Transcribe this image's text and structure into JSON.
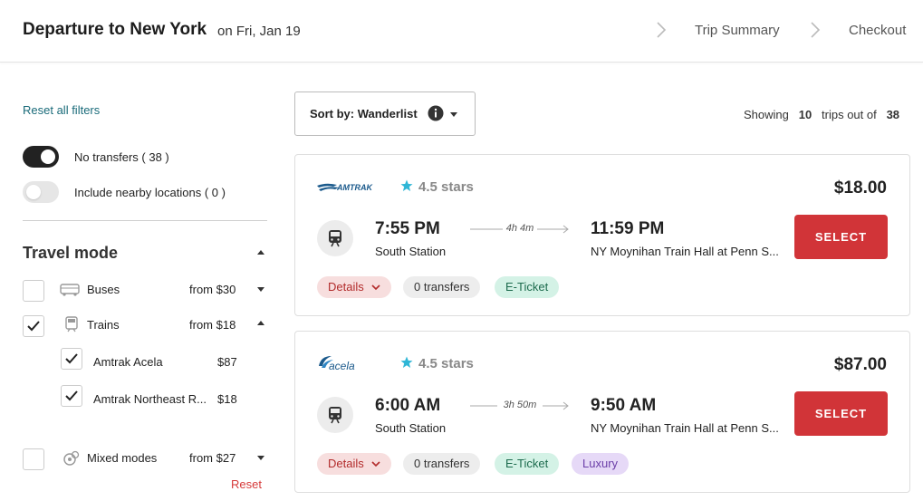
{
  "header": {
    "title": "Departure to New York",
    "subtitle": "on Fri, Jan 19",
    "breadcrumbs": [
      "Trip Summary",
      "Checkout"
    ]
  },
  "sidebar": {
    "reset_all": "Reset all filters",
    "toggles": [
      {
        "label": "No transfers ( 38 )",
        "on": true
      },
      {
        "label": "Include nearby locations ( 0 )",
        "on": false
      }
    ],
    "section_title": "Travel mode",
    "modes": [
      {
        "label": "Buses",
        "price": "from $30",
        "checked": false,
        "icon": "bus-icon"
      },
      {
        "label": "Trains",
        "price": "from $18",
        "checked": true,
        "icon": "train-icon"
      },
      {
        "label": "Amtrak Acela",
        "price": "$87",
        "checked": true
      },
      {
        "label": "Amtrak Northeast R...",
        "price": "$18",
        "checked": true
      },
      {
        "label": "Mixed modes",
        "price": "from $27",
        "checked": false,
        "icon": "mixed-modes-icon"
      }
    ],
    "reset": "Reset"
  },
  "main": {
    "sort_label": "Sort by: Wanderlist",
    "showing": {
      "prefix": "Showing",
      "count": "10",
      "middle": "trips out of",
      "total": "38"
    },
    "results": [
      {
        "logo": "AMTRAK",
        "rating": "4.5 stars",
        "price": "$18.00",
        "depart_time": "7:55 PM",
        "depart_station": "South Station",
        "duration": "4h 4m",
        "arrive_time": "11:59 PM",
        "arrive_station": "NY Moynihan Train Hall at Penn S...",
        "select_label": "SELECT",
        "tags": [
          "Details",
          "0 transfers",
          "E-Ticket"
        ]
      },
      {
        "logo": "acela",
        "rating": "4.5 stars",
        "price": "$87.00",
        "depart_time": "6:00 AM",
        "depart_station": "South Station",
        "duration": "3h 50m",
        "arrive_time": "9:50 AM",
        "arrive_station": "NY Moynihan Train Hall at Penn S...",
        "select_label": "SELECT",
        "tags": [
          "Details",
          "0 transfers",
          "E-Ticket",
          "Luxury"
        ]
      }
    ]
  },
  "colors": {
    "accent_red": "#d13438",
    "link_teal": "#1a6b7a",
    "star_blue": "#2fb6d6"
  }
}
